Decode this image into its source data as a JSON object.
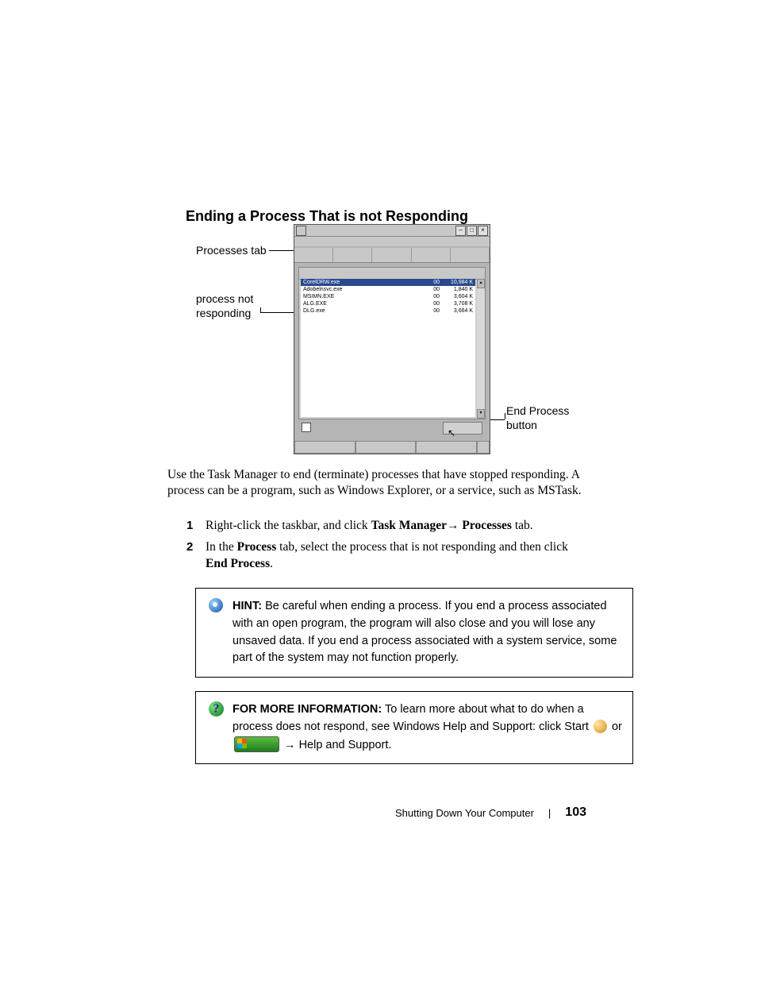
{
  "heading": "Ending a Process That is not Responding",
  "callouts": {
    "processes_tab": "Processes tab",
    "process_not_responding_l1": "process not",
    "process_not_responding_l2": "responding",
    "end_process_l1": "End Process",
    "end_process_l2": "button"
  },
  "taskmgr": {
    "rows": [
      {
        "name": "CorelDRW.exe",
        "cpu": "00",
        "mem": "10,984 K",
        "sel": true
      },
      {
        "name": "Adobelnsvc.exe",
        "cpu": "00",
        "mem": "1,840 K"
      },
      {
        "name": "MSIMN.EXE",
        "cpu": "00",
        "mem": "3,604 K"
      },
      {
        "name": "ALG.EXE",
        "cpu": "00",
        "mem": "3,708 K"
      },
      {
        "name": "DLG.exe",
        "cpu": "00",
        "mem": "3,664 K"
      }
    ]
  },
  "body_text": "Use the Task Manager to end (terminate) processes that have stopped responding. A process can be a program, such as Windows Explorer, or a service, such as MSTask.",
  "steps": {
    "s1_a": "Right-click the taskbar, and click ",
    "s1_b": "Task Manager",
    "s1_arrow": "→ ",
    "s1_c": "Processes",
    "s1_d": " tab.",
    "s2_a": "In the ",
    "s2_b": "Process",
    "s2_c": " tab, select the process that is not responding and then click ",
    "s2_d": "End Process",
    "s2_e": "."
  },
  "hint": {
    "label": "HINT:",
    "text": " Be careful when ending a process. If you end a process associated with an open program, the program will also close and you will lose any unsaved data. If you end a process associated with a system service, some part of the system may not function properly."
  },
  "info": {
    "label": "FOR MORE INFORMATION:",
    "text_a": " To learn more about what to do when a process does not respond, see Windows Help and Support: click Start ",
    "or": " or ",
    "arrow": " → ",
    "help": "Help and Support."
  },
  "footer": {
    "section": "Shutting Down Your Computer",
    "page": "103"
  }
}
